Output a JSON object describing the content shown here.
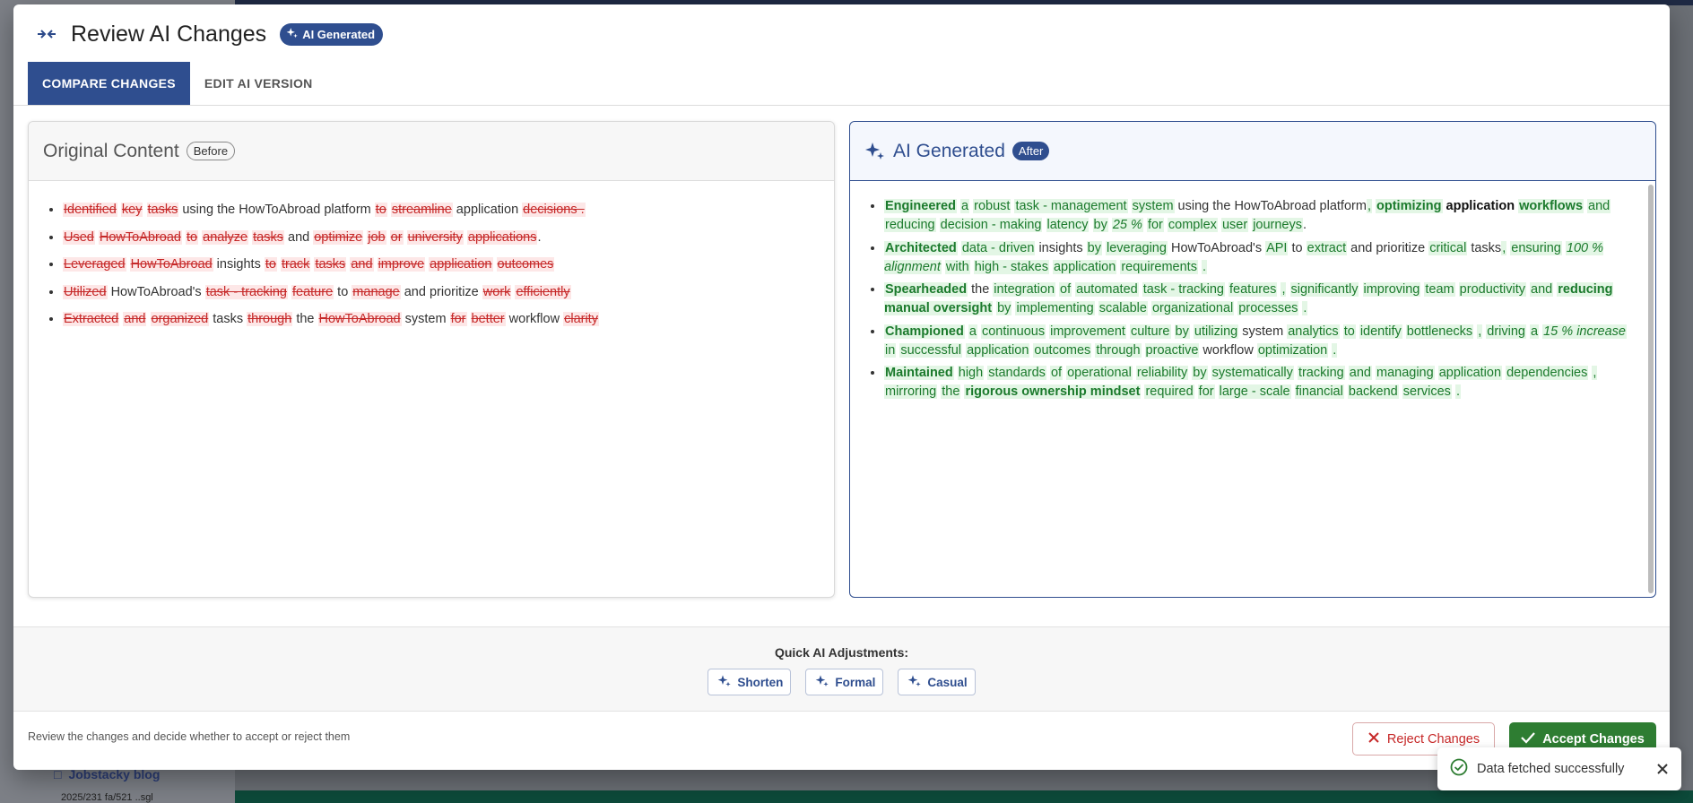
{
  "background": {
    "sidebar_link": "Jobstacky blog",
    "sidebar_sub": "2025/231 fa/521 ..sgl"
  },
  "modal": {
    "title": "Review AI Changes",
    "badge": "AI Generated",
    "tabs": [
      {
        "label": "COMPARE CHANGES",
        "active": true
      },
      {
        "label": "EDIT AI VERSION",
        "active": false
      }
    ]
  },
  "original": {
    "title": "Original Content",
    "badge": "Before",
    "items": [
      [
        {
          "t": "Identified",
          "k": "del"
        },
        {
          "t": " "
        },
        {
          "t": "key",
          "k": "del"
        },
        {
          "t": " "
        },
        {
          "t": "tasks",
          "k": "del"
        },
        {
          "t": " using the HowToAbroad platform "
        },
        {
          "t": "to",
          "k": "del"
        },
        {
          "t": " "
        },
        {
          "t": "streamline",
          "k": "del"
        },
        {
          "t": " application "
        },
        {
          "t": "decisions .",
          "k": "del"
        }
      ],
      [
        {
          "t": "Used",
          "k": "del"
        },
        {
          "t": " "
        },
        {
          "t": "HowToAbroad",
          "k": "del"
        },
        {
          "t": " "
        },
        {
          "t": "to",
          "k": "del"
        },
        {
          "t": " "
        },
        {
          "t": "analyze",
          "k": "del"
        },
        {
          "t": " "
        },
        {
          "t": "tasks",
          "k": "del"
        },
        {
          "t": " and "
        },
        {
          "t": "optimize",
          "k": "del"
        },
        {
          "t": " "
        },
        {
          "t": "job",
          "k": "del"
        },
        {
          "t": " "
        },
        {
          "t": "or",
          "k": "del"
        },
        {
          "t": " "
        },
        {
          "t": "university",
          "k": "del"
        },
        {
          "t": " "
        },
        {
          "t": "applications",
          "k": "del"
        },
        {
          "t": "."
        }
      ],
      [
        {
          "t": "Leveraged",
          "k": "del"
        },
        {
          "t": " "
        },
        {
          "t": "HowToAbroad",
          "k": "del"
        },
        {
          "t": " insights "
        },
        {
          "t": "to",
          "k": "del"
        },
        {
          "t": " "
        },
        {
          "t": "track",
          "k": "del"
        },
        {
          "t": " "
        },
        {
          "t": "tasks",
          "k": "del"
        },
        {
          "t": " "
        },
        {
          "t": "and",
          "k": "del"
        },
        {
          "t": " "
        },
        {
          "t": "improve",
          "k": "del"
        },
        {
          "t": " "
        },
        {
          "t": "application",
          "k": "del"
        },
        {
          "t": " "
        },
        {
          "t": "outcomes",
          "k": "del"
        }
      ],
      [
        {
          "t": "Utilized",
          "k": "del"
        },
        {
          "t": " HowToAbroad's "
        },
        {
          "t": "task - tracking",
          "k": "del"
        },
        {
          "t": " "
        },
        {
          "t": "feature",
          "k": "del"
        },
        {
          "t": " to "
        },
        {
          "t": "manage",
          "k": "del"
        },
        {
          "t": " and prioritize "
        },
        {
          "t": "work",
          "k": "del"
        },
        {
          "t": " "
        },
        {
          "t": "efficiently",
          "k": "del"
        }
      ],
      [
        {
          "t": "Extracted",
          "k": "del"
        },
        {
          "t": " "
        },
        {
          "t": "and",
          "k": "del"
        },
        {
          "t": " "
        },
        {
          "t": "organized",
          "k": "del"
        },
        {
          "t": " tasks "
        },
        {
          "t": "through",
          "k": "del"
        },
        {
          "t": " the "
        },
        {
          "t": "HowToAbroad",
          "k": "del"
        },
        {
          "t": " system "
        },
        {
          "t": "for",
          "k": "del"
        },
        {
          "t": " "
        },
        {
          "t": "better",
          "k": "del"
        },
        {
          "t": " workflow "
        },
        {
          "t": "clarity",
          "k": "del"
        }
      ]
    ]
  },
  "generated": {
    "title": "AI Generated",
    "badge": "After",
    "items": [
      [
        {
          "t": "Engineered",
          "k": "insb"
        },
        {
          "t": " "
        },
        {
          "t": "a",
          "k": "ins"
        },
        {
          "t": " "
        },
        {
          "t": "robust",
          "k": "ins"
        },
        {
          "t": " "
        },
        {
          "t": "task - management",
          "k": "ins"
        },
        {
          "t": " "
        },
        {
          "t": "system",
          "k": "ins"
        },
        {
          "t": " using the HowToAbroad platform"
        },
        {
          "t": ",",
          "k": "ins"
        },
        {
          "t": " "
        },
        {
          "t": "optimizing",
          "k": "insb"
        },
        {
          "t": " "
        },
        {
          "t": "application",
          "k": "keepb"
        },
        {
          "t": " "
        },
        {
          "t": "workflows",
          "k": "insb"
        },
        {
          "t": " "
        },
        {
          "t": "and",
          "k": "ins"
        },
        {
          "t": " "
        },
        {
          "t": "reducing",
          "k": "ins"
        },
        {
          "t": " "
        },
        {
          "t": "decision - making",
          "k": "ins"
        },
        {
          "t": " "
        },
        {
          "t": "latency",
          "k": "ins"
        },
        {
          "t": " "
        },
        {
          "t": "by",
          "k": "ins"
        },
        {
          "t": " "
        },
        {
          "t": "25 %",
          "k": "insi"
        },
        {
          "t": " "
        },
        {
          "t": "for",
          "k": "ins"
        },
        {
          "t": " "
        },
        {
          "t": "complex",
          "k": "ins"
        },
        {
          "t": " "
        },
        {
          "t": "user",
          "k": "ins"
        },
        {
          "t": " "
        },
        {
          "t": "journeys",
          "k": "ins"
        },
        {
          "t": "."
        }
      ],
      [
        {
          "t": "Architected",
          "k": "insb"
        },
        {
          "t": " "
        },
        {
          "t": "data - driven",
          "k": "ins"
        },
        {
          "t": " insights "
        },
        {
          "t": "by",
          "k": "ins"
        },
        {
          "t": " "
        },
        {
          "t": "leveraging",
          "k": "ins"
        },
        {
          "t": " HowToAbroad's "
        },
        {
          "t": "API",
          "k": "ins"
        },
        {
          "t": " to "
        },
        {
          "t": "extract",
          "k": "ins"
        },
        {
          "t": " and prioritize "
        },
        {
          "t": "critical",
          "k": "ins"
        },
        {
          "t": " tasks"
        },
        {
          "t": ",",
          "k": "ins"
        },
        {
          "t": " "
        },
        {
          "t": "ensuring",
          "k": "ins"
        },
        {
          "t": " "
        },
        {
          "t": "100 % alignment",
          "k": "insi"
        },
        {
          "t": " "
        },
        {
          "t": "with",
          "k": "ins"
        },
        {
          "t": " "
        },
        {
          "t": "high - stakes",
          "k": "ins"
        },
        {
          "t": " "
        },
        {
          "t": "application",
          "k": "ins"
        },
        {
          "t": " "
        },
        {
          "t": "requirements",
          "k": "ins"
        },
        {
          "t": " "
        },
        {
          "t": ".",
          "k": "ins"
        }
      ],
      [
        {
          "t": "Spearheaded",
          "k": "insb"
        },
        {
          "t": " the "
        },
        {
          "t": "integration",
          "k": "ins"
        },
        {
          "t": " "
        },
        {
          "t": "of",
          "k": "ins"
        },
        {
          "t": " "
        },
        {
          "t": "automated",
          "k": "ins"
        },
        {
          "t": " "
        },
        {
          "t": "task - tracking",
          "k": "ins"
        },
        {
          "t": " "
        },
        {
          "t": "features",
          "k": "ins"
        },
        {
          "t": " "
        },
        {
          "t": ",",
          "k": "ins"
        },
        {
          "t": " "
        },
        {
          "t": "significantly",
          "k": "ins"
        },
        {
          "t": " "
        },
        {
          "t": "improving",
          "k": "ins"
        },
        {
          "t": " "
        },
        {
          "t": "team",
          "k": "ins"
        },
        {
          "t": " "
        },
        {
          "t": "productivity",
          "k": "ins"
        },
        {
          "t": " "
        },
        {
          "t": "and",
          "k": "ins"
        },
        {
          "t": " "
        },
        {
          "t": "reducing manual oversight",
          "k": "insb"
        },
        {
          "t": " "
        },
        {
          "t": "by",
          "k": "ins"
        },
        {
          "t": " "
        },
        {
          "t": "implementing",
          "k": "ins"
        },
        {
          "t": " "
        },
        {
          "t": "scalable",
          "k": "ins"
        },
        {
          "t": " "
        },
        {
          "t": "organizational",
          "k": "ins"
        },
        {
          "t": " "
        },
        {
          "t": "processes",
          "k": "ins"
        },
        {
          "t": " "
        },
        {
          "t": ".",
          "k": "ins"
        }
      ],
      [
        {
          "t": "Championed",
          "k": "insb"
        },
        {
          "t": " "
        },
        {
          "t": "a",
          "k": "ins"
        },
        {
          "t": " "
        },
        {
          "t": "continuous",
          "k": "ins"
        },
        {
          "t": " "
        },
        {
          "t": "improvement",
          "k": "ins"
        },
        {
          "t": " "
        },
        {
          "t": "culture",
          "k": "ins"
        },
        {
          "t": " "
        },
        {
          "t": "by",
          "k": "ins"
        },
        {
          "t": " "
        },
        {
          "t": "utilizing",
          "k": "ins"
        },
        {
          "t": " system "
        },
        {
          "t": "analytics",
          "k": "ins"
        },
        {
          "t": " "
        },
        {
          "t": "to",
          "k": "ins"
        },
        {
          "t": " "
        },
        {
          "t": "identify",
          "k": "ins"
        },
        {
          "t": " "
        },
        {
          "t": "bottlenecks",
          "k": "ins"
        },
        {
          "t": " "
        },
        {
          "t": ",",
          "k": "ins"
        },
        {
          "t": " "
        },
        {
          "t": "driving",
          "k": "ins"
        },
        {
          "t": " "
        },
        {
          "t": "a",
          "k": "ins"
        },
        {
          "t": " "
        },
        {
          "t": "15 % increase",
          "k": "insi"
        },
        {
          "t": " "
        },
        {
          "t": "in",
          "k": "ins"
        },
        {
          "t": " "
        },
        {
          "t": "successful",
          "k": "ins"
        },
        {
          "t": " "
        },
        {
          "t": "application",
          "k": "ins"
        },
        {
          "t": " "
        },
        {
          "t": "outcomes",
          "k": "ins"
        },
        {
          "t": " "
        },
        {
          "t": "through",
          "k": "ins"
        },
        {
          "t": " "
        },
        {
          "t": "proactive",
          "k": "ins"
        },
        {
          "t": " workflow "
        },
        {
          "t": "optimization",
          "k": "ins"
        },
        {
          "t": " "
        },
        {
          "t": ".",
          "k": "ins"
        }
      ],
      [
        {
          "t": "Maintained",
          "k": "insb"
        },
        {
          "t": " "
        },
        {
          "t": "high",
          "k": "ins"
        },
        {
          "t": " "
        },
        {
          "t": "standards",
          "k": "ins"
        },
        {
          "t": " "
        },
        {
          "t": "of",
          "k": "ins"
        },
        {
          "t": " "
        },
        {
          "t": "operational",
          "k": "ins"
        },
        {
          "t": " "
        },
        {
          "t": "reliability",
          "k": "ins"
        },
        {
          "t": " "
        },
        {
          "t": "by",
          "k": "ins"
        },
        {
          "t": " "
        },
        {
          "t": "systematically",
          "k": "ins"
        },
        {
          "t": " "
        },
        {
          "t": "tracking",
          "k": "ins"
        },
        {
          "t": " "
        },
        {
          "t": "and",
          "k": "ins"
        },
        {
          "t": " "
        },
        {
          "t": "managing",
          "k": "ins"
        },
        {
          "t": " "
        },
        {
          "t": "application",
          "k": "ins"
        },
        {
          "t": " "
        },
        {
          "t": "dependencies",
          "k": "ins"
        },
        {
          "t": " "
        },
        {
          "t": ",",
          "k": "ins"
        },
        {
          "t": " "
        },
        {
          "t": "mirroring",
          "k": "ins"
        },
        {
          "t": " "
        },
        {
          "t": "the",
          "k": "ins"
        },
        {
          "t": " "
        },
        {
          "t": "rigorous ownership mindset",
          "k": "insb"
        },
        {
          "t": " "
        },
        {
          "t": "required",
          "k": "ins"
        },
        {
          "t": " "
        },
        {
          "t": "for",
          "k": "ins"
        },
        {
          "t": " "
        },
        {
          "t": "large - scale",
          "k": "ins"
        },
        {
          "t": " "
        },
        {
          "t": "financial",
          "k": "ins"
        },
        {
          "t": " "
        },
        {
          "t": "backend",
          "k": "ins"
        },
        {
          "t": " "
        },
        {
          "t": "services",
          "k": "ins"
        },
        {
          "t": " "
        },
        {
          "t": ".",
          "k": "ins"
        }
      ]
    ]
  },
  "quick": {
    "label": "Quick AI Adjustments:",
    "buttons": [
      "Shorten",
      "Formal",
      "Casual"
    ]
  },
  "footer": {
    "hint": "Review the changes and decide whether to accept or reject them",
    "reject_label": "Reject Changes",
    "accept_label": "Accept Changes"
  },
  "toast": {
    "message": "Data fetched successfully"
  },
  "colors": {
    "primary": "#2f4e8f",
    "deleted": "#c62828",
    "inserted": "#1b7a2c",
    "accept": "#2e7d32"
  },
  "icons": {
    "header": "collapse-arrows-icon",
    "sparkle": "sparkle-icon",
    "reject": "close-icon",
    "accept": "check-icon",
    "toast": "check-circle-icon"
  }
}
